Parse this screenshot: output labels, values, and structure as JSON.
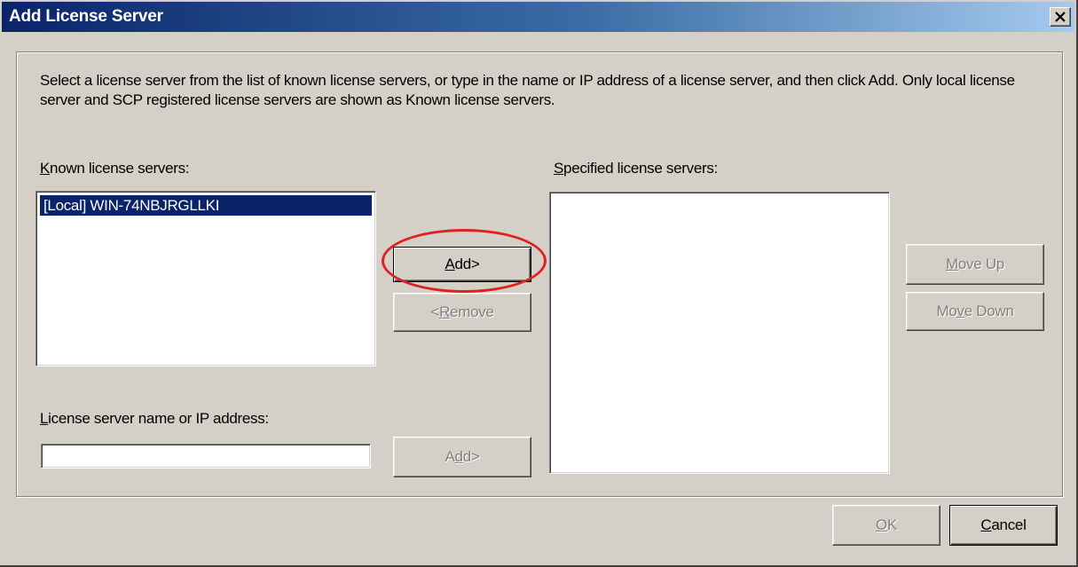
{
  "window": {
    "title": "Add License Server",
    "close_symbol": "×"
  },
  "instructions": "Select a license server from the list of known license servers, or type in the name or IP address of a license server, and then click Add. Only local license server and SCP registered license servers are shown as Known license servers.",
  "known": {
    "label_mnemonic": "K",
    "label_rest": "nown license servers:",
    "items": [
      "[Local] WIN-74NBJRGLLKI"
    ],
    "selected_index": 0
  },
  "specified": {
    "label_mnemonic": "S",
    "label_rest": "pecified license servers:",
    "items": []
  },
  "buttons": {
    "add_mnemonic": "A",
    "add_rest": "dd>",
    "remove_prefix": "<",
    "remove_mnemonic": "R",
    "remove_rest": "emove",
    "move_up_mnemonic": "M",
    "move_up_rest": "ove Up",
    "move_down_pre": "Mo",
    "move_down_mnemonic": "v",
    "move_down_rest": "e Down",
    "add2_pre": "A",
    "add2_mnemonic": "d",
    "add2_rest": "d>",
    "ok_mnemonic": "O",
    "ok_rest": "K",
    "cancel_mnemonic": "C",
    "cancel_rest": "ancel"
  },
  "server_input": {
    "label_mnemonic": "L",
    "label_rest": "icense server name or IP address:",
    "value": ""
  },
  "colors": {
    "annotation": "#e02020",
    "selection": "#0a246a"
  }
}
